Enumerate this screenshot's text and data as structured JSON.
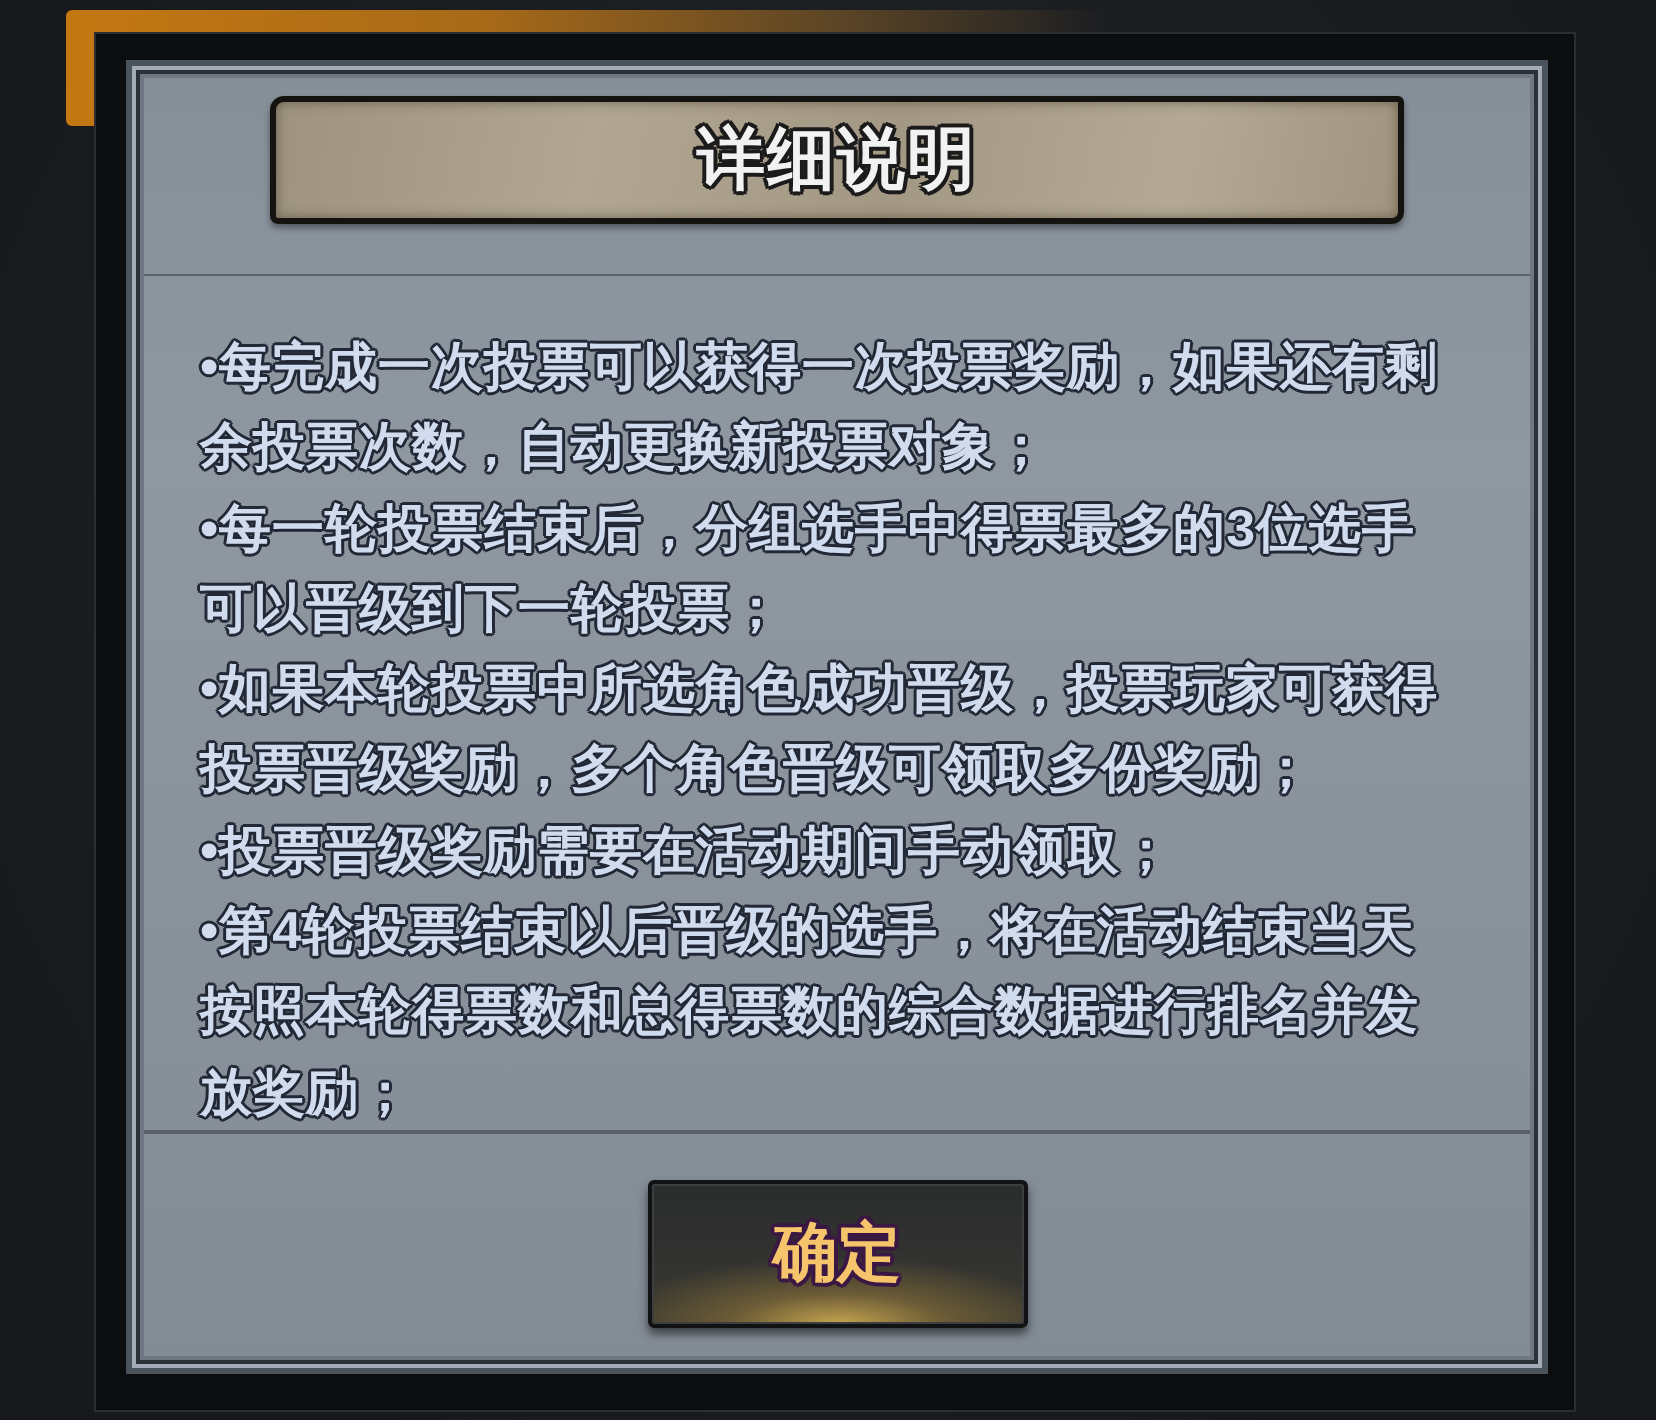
{
  "dialog": {
    "title": "详细说明",
    "rules": [
      {
        "lines": [
          "•每完成一次投票可以获得一次投票奖励，如果还有剩",
          "余投票次数，自动更换新投票对象；"
        ]
      },
      {
        "lines": [
          "•每一轮投票结束后，分组选手中得票最多的3位选手",
          "可以晋级到下一轮投票；"
        ]
      },
      {
        "lines": [
          "•如果本轮投票中所选角色成功晋级，投票玩家可获得",
          "投票晋级奖励，多个角色晋级可领取多份奖励；"
        ]
      },
      {
        "lines": [
          "•投票晋级奖励需要在活动期间手动领取；"
        ]
      },
      {
        "lines": [
          "•第4轮投票结束以后晋级的选手，将在活动结束当天",
          "按照本轮得票数和总得票数的综合数据进行排名并发",
          "放奖励；"
        ]
      }
    ],
    "confirm_button": "确定"
  }
}
